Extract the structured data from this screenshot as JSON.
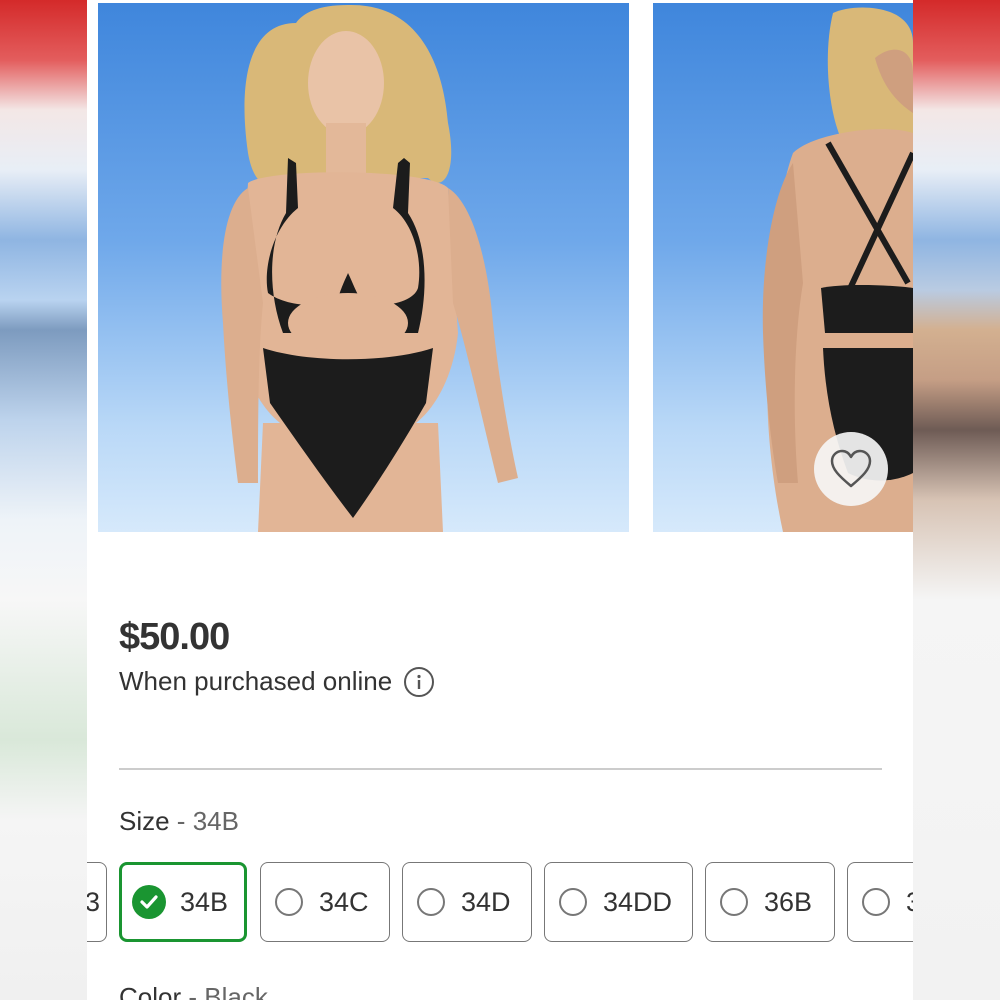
{
  "product": {
    "price": "$50.00",
    "price_note": "When purchased online",
    "images": [
      {
        "alt": "Model wearing black cut-out one-piece swimsuit, front view"
      },
      {
        "alt": "Model wearing black one-piece swimsuit, back view with crisscross straps"
      }
    ]
  },
  "icons": {
    "favorite": "heart-outline-icon",
    "info": "info-circle-icon",
    "selected": "checkmark-circle-icon"
  },
  "size": {
    "label": "Size",
    "separator": " - ",
    "selected": "34B",
    "options": [
      "3",
      "34B",
      "34C",
      "34D",
      "34DD",
      "36B",
      "3"
    ]
  },
  "color": {
    "label": "Color",
    "separator": " - ",
    "selected": "Black"
  },
  "colors": {
    "accent_green": "#1a9531",
    "text": "#333333",
    "muted": "#666666"
  }
}
